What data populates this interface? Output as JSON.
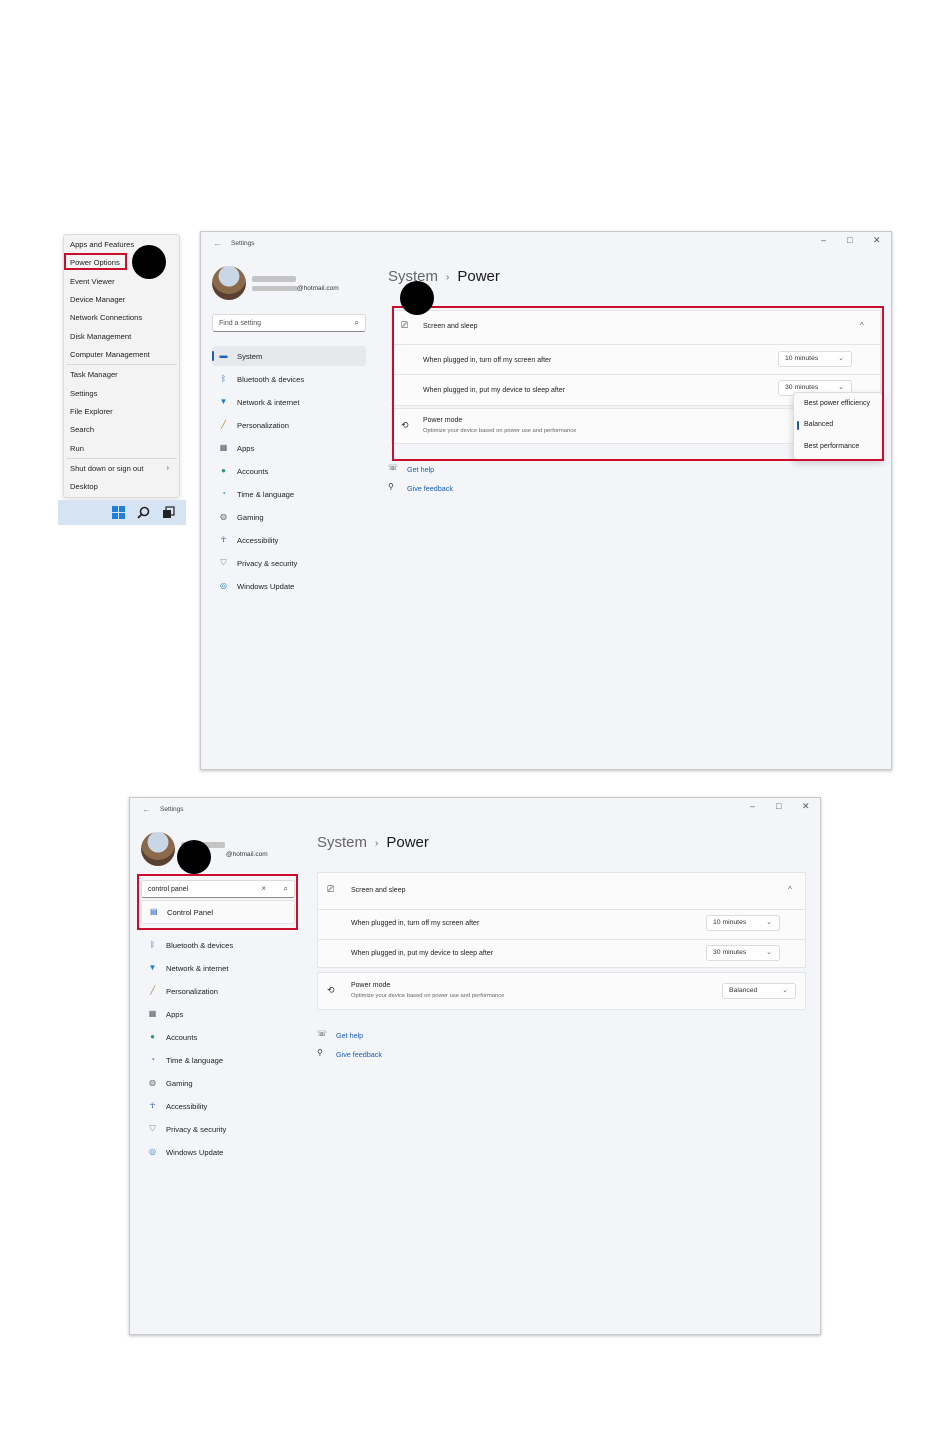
{
  "winx_menu": {
    "items": [
      "Apps and Features",
      "Power Options",
      "Event Viewer",
      "Device Manager",
      "Network Connections",
      "Disk Management",
      "Computer Management",
      "Task Manager",
      "Settings",
      "File Explorer",
      "Search",
      "Run",
      "Shut down or sign out",
      "Desktop"
    ]
  },
  "taskbar": {
    "icons": [
      "windows-logo-icon",
      "search-icon",
      "task-view-icon"
    ]
  },
  "settings_window_1": {
    "title": "Settings",
    "account": {
      "email": "@hotmail.com"
    },
    "search": {
      "placeholder": "Find a setting"
    },
    "nav": [
      {
        "label": "System",
        "icon": "system-icon",
        "selected": true
      },
      {
        "label": "Bluetooth & devices",
        "icon": "bluetooth-icon"
      },
      {
        "label": "Network & internet",
        "icon": "wifi-icon"
      },
      {
        "label": "Personalization",
        "icon": "brush-icon"
      },
      {
        "label": "Apps",
        "icon": "apps-icon"
      },
      {
        "label": "Accounts",
        "icon": "accounts-icon"
      },
      {
        "label": "Time & language",
        "icon": "globe-icon"
      },
      {
        "label": "Gaming",
        "icon": "gaming-icon"
      },
      {
        "label": "Accessibility",
        "icon": "accessibility-icon"
      },
      {
        "label": "Privacy & security",
        "icon": "shield-icon"
      },
      {
        "label": "Windows Update",
        "icon": "update-icon"
      }
    ],
    "breadcrumb": {
      "parent": "System",
      "separator": "›",
      "current": "Power"
    },
    "screen_sleep": {
      "title": "Screen and sleep",
      "screen_off_label": "When plugged in, turn off my screen after",
      "screen_off_value": "10 minutes",
      "sleep_label": "When plugged in, put my device to sleep after",
      "sleep_value": "30 minutes"
    },
    "power_mode": {
      "title": "Power mode",
      "description": "Optimize your device based on power use and performance",
      "options": [
        "Best power efficiency",
        "Balanced",
        "Best performance"
      ],
      "selected": "Balanced"
    },
    "links": {
      "help": "Get help",
      "feedback": "Give feedback"
    }
  },
  "settings_window_2": {
    "title": "Settings",
    "account": {
      "email": "@hotmail.com"
    },
    "search": {
      "value": "control panel",
      "result": "Control Panel"
    },
    "nav": [
      {
        "label": "Bluetooth & devices",
        "icon": "bluetooth-icon"
      },
      {
        "label": "Network & internet",
        "icon": "wifi-icon"
      },
      {
        "label": "Personalization",
        "icon": "brush-icon"
      },
      {
        "label": "Apps",
        "icon": "apps-icon"
      },
      {
        "label": "Accounts",
        "icon": "accounts-icon"
      },
      {
        "label": "Time & language",
        "icon": "globe-icon"
      },
      {
        "label": "Gaming",
        "icon": "gaming-icon"
      },
      {
        "label": "Accessibility",
        "icon": "accessibility-icon"
      },
      {
        "label": "Privacy & security",
        "icon": "shield-icon"
      },
      {
        "label": "Windows Update",
        "icon": "update-icon"
      }
    ],
    "breadcrumb": {
      "parent": "System",
      "separator": "›",
      "current": "Power"
    },
    "screen_sleep": {
      "title": "Screen and sleep",
      "screen_off_label": "When plugged in, turn off my screen after",
      "screen_off_value": "10 minutes",
      "sleep_label": "When plugged in, put my device to sleep after",
      "sleep_value": "30 minutes"
    },
    "power_mode": {
      "title": "Power mode",
      "description": "Optimize your device based on power use and performance",
      "value": "Balanced"
    },
    "links": {
      "help": "Get help",
      "feedback": "Give feedback"
    }
  },
  "colors": {
    "highlight": "#c8102e",
    "accent": "#1a5fb4",
    "step_marker": "#000000"
  }
}
